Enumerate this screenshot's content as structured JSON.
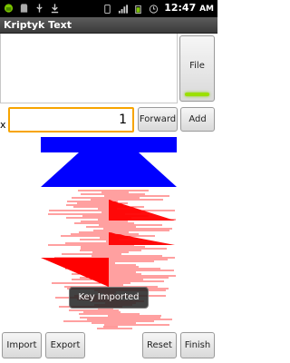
{
  "status_bar": {
    "time": "12:47",
    "ampm": "AM",
    "icons": [
      "android-debug-icon",
      "sd-card-icon",
      "usb-icon",
      "download-icon",
      "vibrate-icon",
      "signal-icon",
      "battery-icon",
      "alarm-icon"
    ]
  },
  "title_bar": {
    "title": "Kriptyk Text"
  },
  "editor": {
    "text": ""
  },
  "controls": {
    "file_label": "File",
    "x_label": "x",
    "number_value": "1",
    "forward_label": "Forward",
    "add_label": "Add"
  },
  "toast": {
    "message": "Key Imported"
  },
  "bottom_bar": {
    "import_label": "Import",
    "export_label": "Export",
    "reset_label": "Reset",
    "finish_label": "Finish"
  },
  "colors": {
    "accent_input": "#f7a400",
    "led_green": "#9be000",
    "viz_blue": "#0000ff",
    "viz_red": "#ff0000"
  }
}
